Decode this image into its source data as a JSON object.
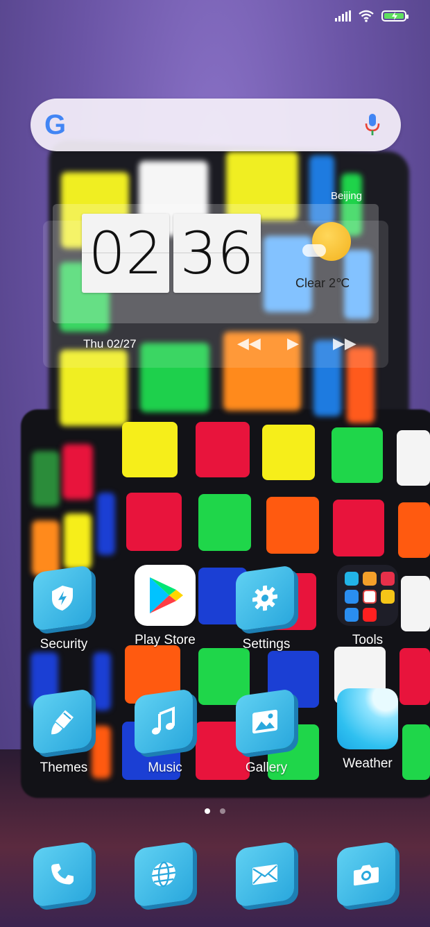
{
  "status_bar": {
    "signal": "signal-icon",
    "wifi": "wifi-icon",
    "battery": "battery-charging-icon"
  },
  "search": {
    "logo": "G",
    "mic": "mic-icon"
  },
  "clock_widget": {
    "city": "Beijing",
    "hour": "02",
    "minute": "36",
    "weather_text": "Clear  2℃",
    "date": "Thu 02/27",
    "controls": {
      "prev": "◀◀",
      "play": "▶",
      "next": "▶▶"
    }
  },
  "apps": [
    {
      "label": "Security",
      "icon": "shield-icon"
    },
    {
      "label": "Play Store",
      "icon": "play-store-icon"
    },
    {
      "label": "Settings",
      "icon": "gear-icon"
    },
    {
      "label": "Tools",
      "icon": "folder-icon"
    },
    {
      "label": "Themes",
      "icon": "brush-icon"
    },
    {
      "label": "Music",
      "icon": "music-note-icon"
    },
    {
      "label": "Gallery",
      "icon": "image-icon"
    },
    {
      "label": "Weather",
      "icon": "weather-icon"
    }
  ],
  "dock": [
    {
      "icon": "phone-icon"
    },
    {
      "icon": "browser-globe-icon"
    },
    {
      "icon": "mail-icon"
    },
    {
      "icon": "camera-icon"
    }
  ],
  "pages": {
    "count": 2,
    "active": 1
  },
  "colors": {
    "icon_tile": "#2aa8dd",
    "wallpaper": "#6f5aa8"
  }
}
